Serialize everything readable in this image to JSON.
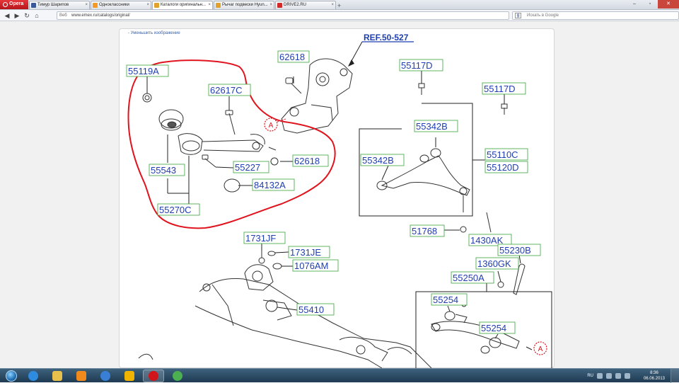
{
  "browser": {
    "menu_label": "Opera",
    "tabs": [
      {
        "label": "Тимур Шарипов",
        "color": "#3b5998",
        "active": false
      },
      {
        "label": "Одноклассники",
        "color": "#f59a23",
        "active": false
      },
      {
        "label": "Каталоги оригинальн...",
        "color": "#e0a22d",
        "active": true
      },
      {
        "label": "Рычаг подвески Hyun...",
        "color": "#e0a22d",
        "active": false
      },
      {
        "label": "DRIVE2.RU",
        "color": "#d12a2a",
        "active": false
      }
    ],
    "url_prefix": "Веб",
    "url": "www.emex.ru/catalogs/original/",
    "search_placeholder": "Искать в Google",
    "search_engine_icon": "google-icon"
  },
  "page": {
    "shrink_link": "- Уменьшить изображение",
    "ref_label": "REF.50-527",
    "callout_marker": "A",
    "part_labels": [
      {
        "id": "p55119A",
        "text": "55119A"
      },
      {
        "id": "p62617C",
        "text": "62617C"
      },
      {
        "id": "p62618a",
        "text": "62618"
      },
      {
        "id": "p62618b",
        "text": "62618"
      },
      {
        "id": "p55227",
        "text": "55227"
      },
      {
        "id": "p55543",
        "text": "55543"
      },
      {
        "id": "p84132A",
        "text": "84132A"
      },
      {
        "id": "p55270C",
        "text": "55270C"
      },
      {
        "id": "p55117Da",
        "text": "55117D"
      },
      {
        "id": "p55117Db",
        "text": "55117D"
      },
      {
        "id": "p55342Ba",
        "text": "55342B"
      },
      {
        "id": "p55342Bb",
        "text": "55342B"
      },
      {
        "id": "p55110C",
        "text": "55110C"
      },
      {
        "id": "p55120D",
        "text": "55120D"
      },
      {
        "id": "p51768",
        "text": "51768"
      },
      {
        "id": "p1430AK",
        "text": "1430AK"
      },
      {
        "id": "p55230B",
        "text": "55230B"
      },
      {
        "id": "p1731JF",
        "text": "1731JF"
      },
      {
        "id": "p1731JE",
        "text": "1731JE"
      },
      {
        "id": "p1076AM",
        "text": "1076AM"
      },
      {
        "id": "p1360GK",
        "text": "1360GK"
      },
      {
        "id": "p55250A",
        "text": "55250A"
      },
      {
        "id": "p55410",
        "text": "55410"
      },
      {
        "id": "p55254a",
        "text": "55254"
      },
      {
        "id": "p55254b",
        "text": "55254"
      }
    ],
    "highlight_color": "#e0141e",
    "label_color": "#1f3fb0",
    "label_border": "#3aa63a"
  },
  "taskbar": {
    "apps": [
      {
        "name": "ie-icon",
        "color": "#2f8be0"
      },
      {
        "name": "explorer-icon",
        "color": "#e8c04c"
      },
      {
        "name": "media-player-icon",
        "color": "#f08a1c"
      },
      {
        "name": "network-icon",
        "color": "#3a7fd6"
      },
      {
        "name": "avast-icon",
        "color": "#f0b400"
      },
      {
        "name": "opera-icon",
        "color": "#d1151b"
      },
      {
        "name": "chrome-icon",
        "color": "#4caf50"
      }
    ],
    "language": "RU",
    "time": "8:36",
    "date": "06.06.2013"
  }
}
